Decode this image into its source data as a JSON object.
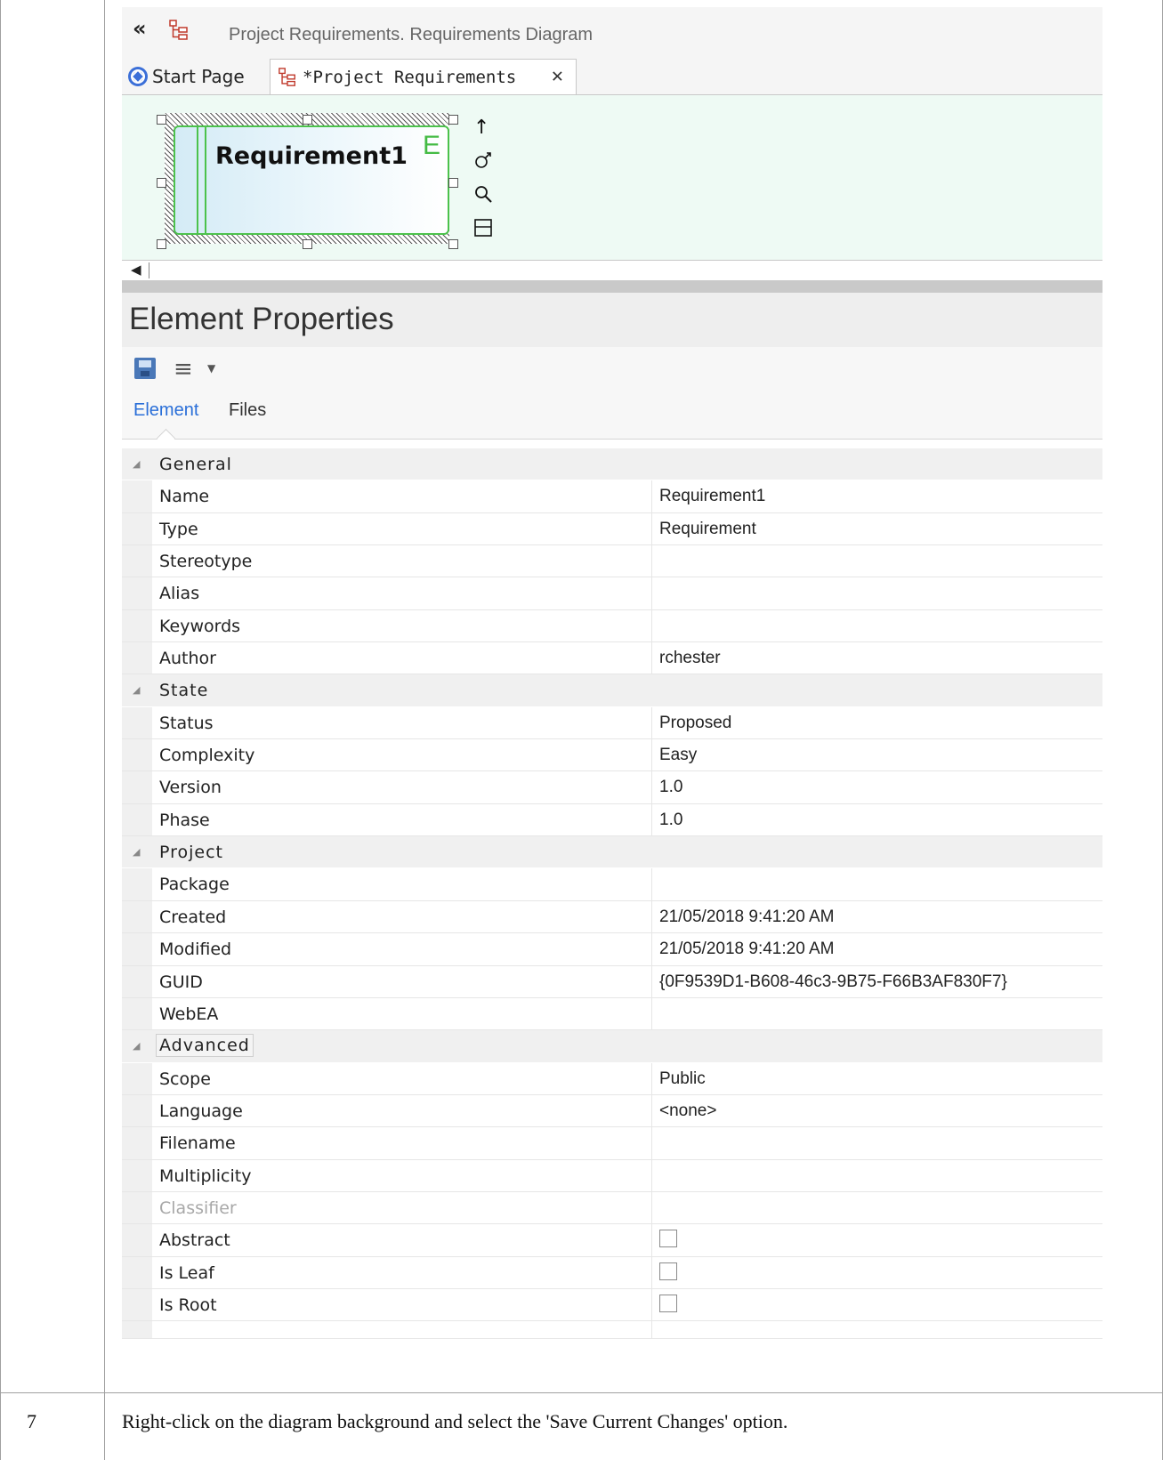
{
  "step": {
    "number": "7",
    "instruction": "Right-click on the diagram background and select the 'Save Current Changes' option."
  },
  "window": {
    "breadcrumb": "Project Requirements.  Requirements Diagram",
    "tabs": [
      {
        "label": "Start Page"
      },
      {
        "label": "*Project Requirements",
        "close": "✕"
      }
    ]
  },
  "diagram": {
    "element_name": "Requirement1",
    "element_glyph": "E"
  },
  "properties": {
    "title": "Element Properties",
    "subtabs": {
      "element": "Element",
      "files": "Files"
    },
    "sections": {
      "general": "General",
      "state": "State",
      "project": "Project",
      "advanced": "Advanced"
    },
    "rows": {
      "name": {
        "key": "Name",
        "value": "Requirement1"
      },
      "type": {
        "key": "Type",
        "value": "Requirement"
      },
      "stereotype": {
        "key": "Stereotype",
        "value": ""
      },
      "alias": {
        "key": "Alias",
        "value": ""
      },
      "keywords": {
        "key": "Keywords",
        "value": ""
      },
      "author": {
        "key": "Author",
        "value": "rchester"
      },
      "status": {
        "key": "Status",
        "value": "Proposed"
      },
      "complexity": {
        "key": "Complexity",
        "value": "Easy"
      },
      "version": {
        "key": "Version",
        "value": "1.0"
      },
      "phase": {
        "key": "Phase",
        "value": "1.0"
      },
      "package": {
        "key": "Package",
        "value": ""
      },
      "created": {
        "key": "Created",
        "value": "21/05/2018 9:41:20 AM"
      },
      "modified": {
        "key": "Modified",
        "value": "21/05/2018 9:41:20 AM"
      },
      "guid": {
        "key": "GUID",
        "value": "{0F9539D1-B608-46c3-9B75-F66B3AF830F7}"
      },
      "webea": {
        "key": "WebEA",
        "value": ""
      },
      "scope": {
        "key": "Scope",
        "value": "Public"
      },
      "language": {
        "key": "Language",
        "value": "<none>"
      },
      "filename": {
        "key": "Filename",
        "value": ""
      },
      "multiplicity": {
        "key": "Multiplicity",
        "value": ""
      },
      "classifier": {
        "key": "Classifier",
        "value": ""
      },
      "abstract": {
        "key": "Abstract",
        "checked": false
      },
      "is_leaf": {
        "key": "Is Leaf",
        "checked": false
      },
      "is_root": {
        "key": "Is Root",
        "checked": false
      }
    }
  },
  "colors": {
    "canvas_bg": "#eefaf4",
    "requirement_border": "#4cc24c",
    "active_subtab": "#2a6fd8"
  }
}
